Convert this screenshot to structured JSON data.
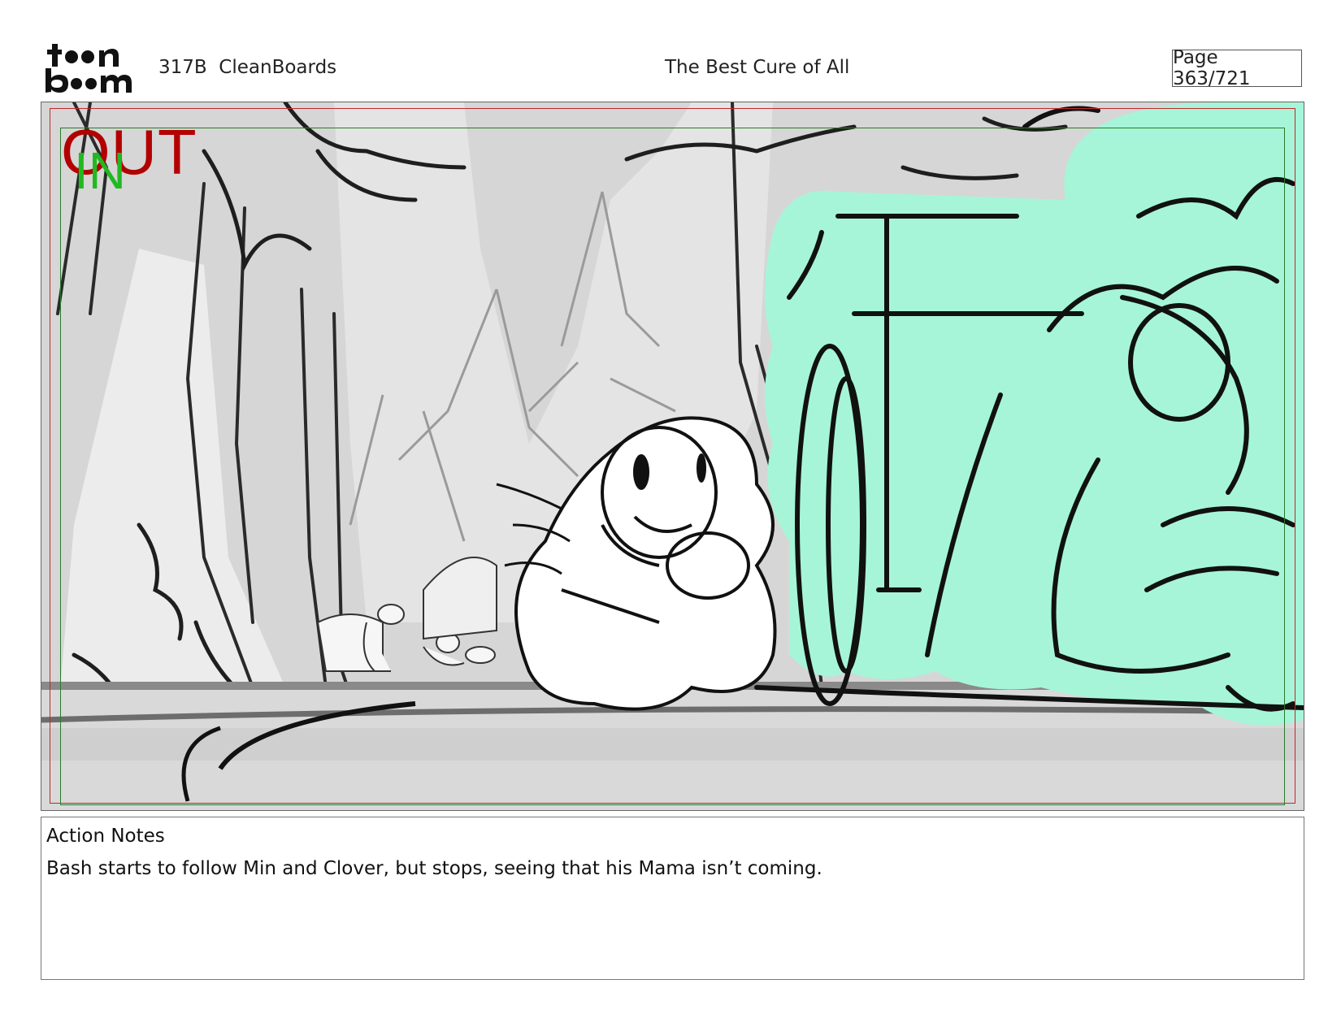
{
  "header": {
    "logo_text": "toon boom",
    "scene_id": "317B  CleanBoards",
    "title": "The Best Cure of All",
    "page": "Page 363/721"
  },
  "panel": {
    "label_out": "OUT",
    "label_in": "IN",
    "colors": {
      "out_frame": "#c0282a",
      "in_frame": "#2a7a2a",
      "creature_fill": "#a6f5d8",
      "background_gray": "#cfcfcf"
    }
  },
  "notes": {
    "heading": "Action Notes",
    "text": "Bash starts to follow Min and Clover, but stops, seeing that his Mama isn’t coming."
  }
}
